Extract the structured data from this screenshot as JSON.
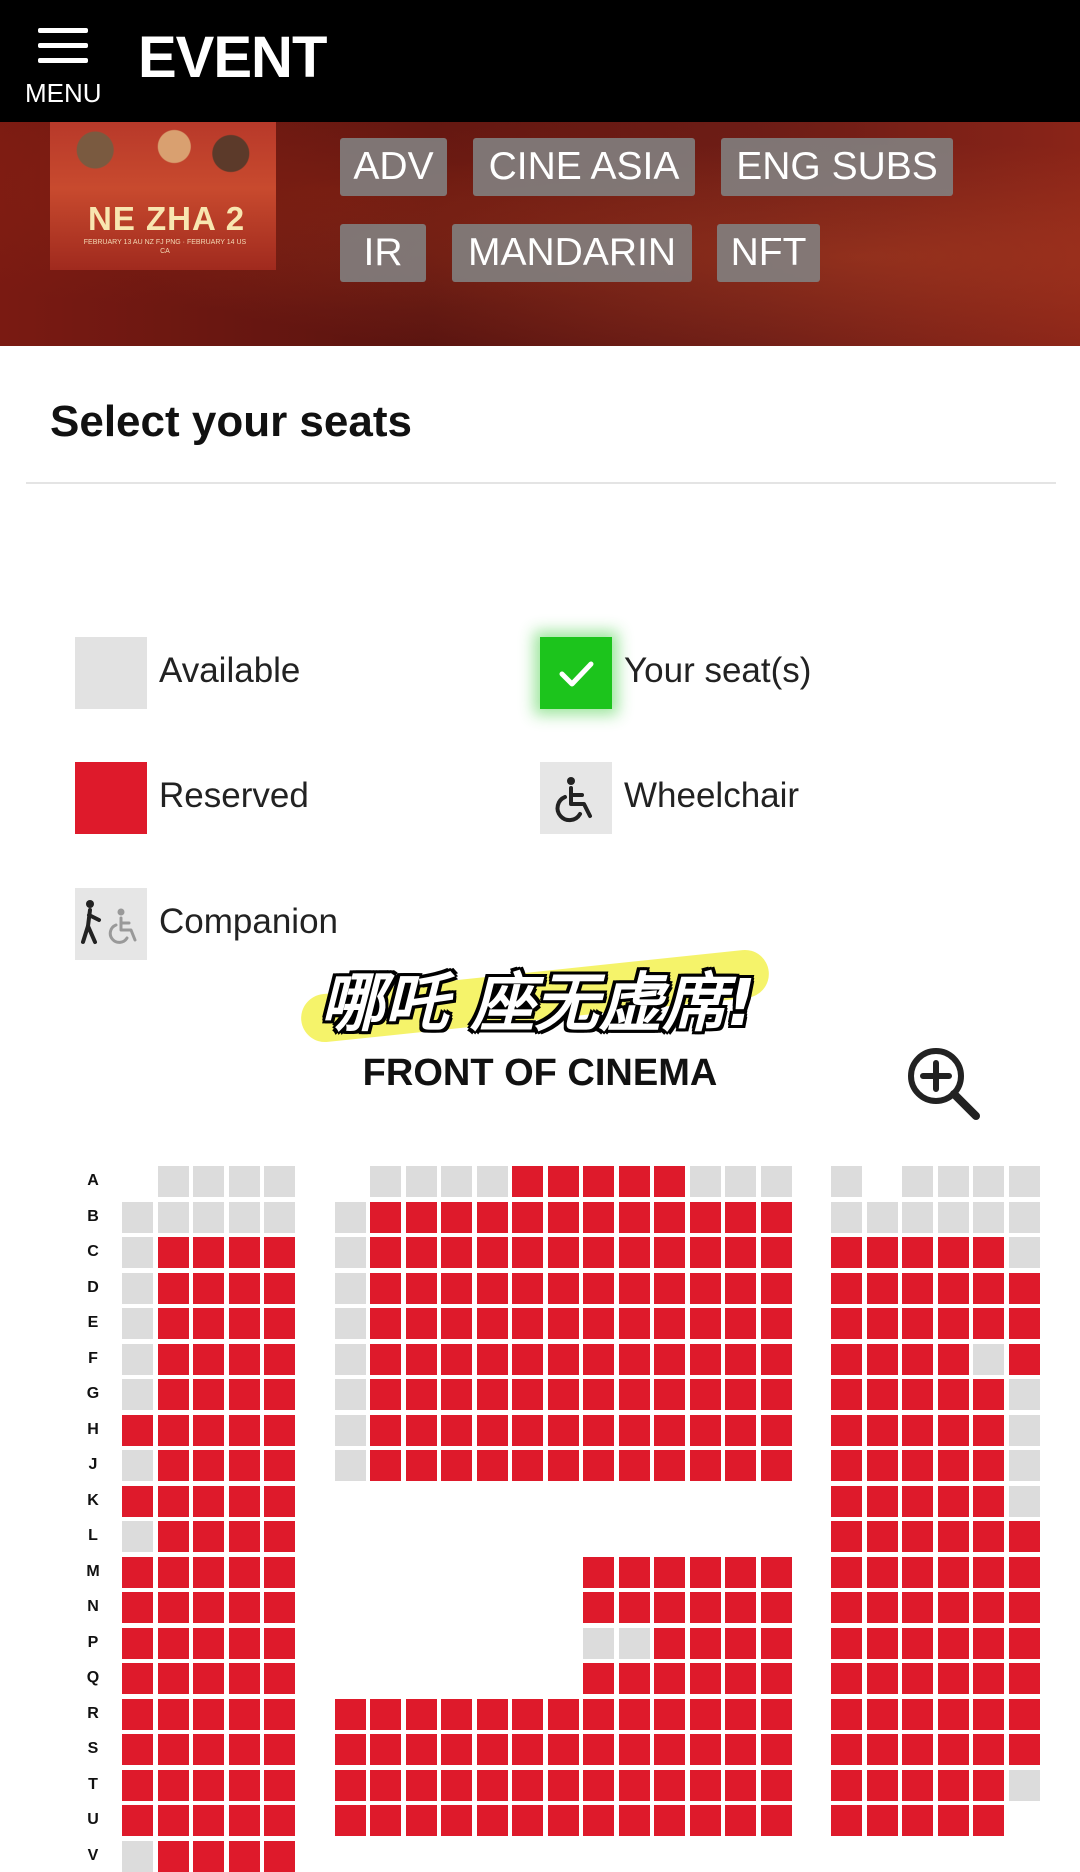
{
  "header": {
    "menu_label": "MENU",
    "brand": "EVENT"
  },
  "movie": {
    "poster_title": "NE ZHA 2",
    "poster_subtitle": "FEBRUARY 13 AU NZ FJ PNG · FEBRUARY 14 US CA",
    "tags": [
      "ADV",
      "CINE ASIA",
      "ENG SUBS",
      "IR",
      "MANDARIN",
      "NFT"
    ]
  },
  "page": {
    "title": "Select your seats"
  },
  "legend": {
    "available": "Available",
    "your_seats": "Your seat(s)",
    "reserved": "Reserved",
    "wheelchair": "Wheelchair",
    "companion": "Companion"
  },
  "overlay_caption": "哪吒 座无虚席!",
  "seat_map": {
    "front_label": "FRONT OF CINEMA",
    "zoom_icon": "zoom-in-icon",
    "colors": {
      "available": "#dcdcdc",
      "reserved": "#de1a2b",
      "your_seat": "#1cc41c"
    },
    "legend_key": {
      "0": "none",
      "1": "available",
      "2": "reserved"
    },
    "rows": [
      {
        "label": "A",
        "seats": "011110111122222111101111"
      },
      {
        "label": "B",
        "seats": "111111222222222222111111"
      },
      {
        "label": "C",
        "seats": "122221222222222222222221"
      },
      {
        "label": "D",
        "seats": "122221222222222222222222"
      },
      {
        "label": "E",
        "seats": "122221222222222222222222"
      },
      {
        "label": "F",
        "seats": "122221222222222222222212"
      },
      {
        "label": "G",
        "seats": "122221222222222222222221"
      },
      {
        "label": "H",
        "seats": "222221222222222222222221"
      },
      {
        "label": "J",
        "seats": "122221222222222222222221"
      },
      {
        "label": "K",
        "seats": "222220000000000000222221"
      },
      {
        "label": "L",
        "seats": "122220000000000000222222"
      },
      {
        "label": "M",
        "seats": "222220000000222222222222"
      },
      {
        "label": "N",
        "seats": "222220000000222222222222"
      },
      {
        "label": "P",
        "seats": "222220000000112222222222"
      },
      {
        "label": "Q",
        "seats": "222220000000222222222222"
      },
      {
        "label": "R",
        "seats": "222222222222222222222222"
      },
      {
        "label": "S",
        "seats": "222222222222222222222222"
      },
      {
        "label": "T",
        "seats": "222222222222222222222221"
      },
      {
        "label": "U",
        "seats": "222222222222222222222220"
      },
      {
        "label": "V",
        "seats": "122220000000000000000000"
      }
    ]
  }
}
